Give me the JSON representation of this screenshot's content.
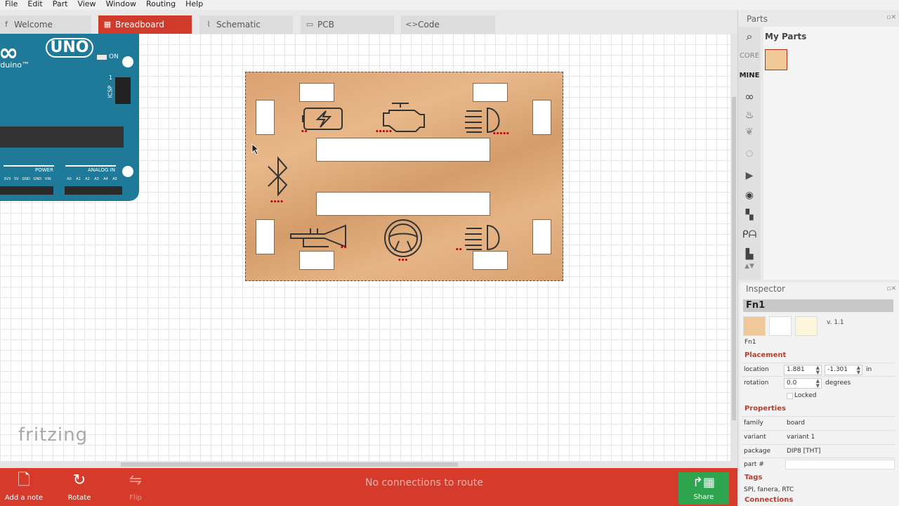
{
  "menu": [
    "File",
    "Edit",
    "Part",
    "View",
    "Window",
    "Routing",
    "Help"
  ],
  "tabs": [
    {
      "label": "Welcome",
      "icon": "fritzing-f-icon"
    },
    {
      "label": "Breadboard",
      "icon": "breadboard-icon",
      "active": true
    },
    {
      "label": "Schematic",
      "icon": "schematic-icon"
    },
    {
      "label": "PCB",
      "icon": "pcb-icon"
    },
    {
      "label": "Code",
      "icon": "code-icon"
    }
  ],
  "arduino": {
    "logo": "∞",
    "model": "UNO",
    "brand": "rduino™",
    "on_label": "ON",
    "icsp_label": "ICSP",
    "icsp_pin": "1",
    "power_label": "POWER",
    "analog_label": "ANALOG IN",
    "power_pins": [
      "3V3",
      "5V",
      "GND",
      "GND",
      "VIN"
    ],
    "analog_pins": [
      "A0",
      "A1",
      "A2",
      "A3",
      "A4",
      "A5"
    ]
  },
  "board": {
    "icons": [
      "battery-icon",
      "engine-icon",
      "headlight-icon",
      "bluetooth-icon",
      "horn-icon",
      "steering-wheel-icon",
      "headlight-icon"
    ],
    "marks": [
      "••",
      "•••••",
      "•••••",
      "••••",
      "••",
      "•••",
      "••"
    ]
  },
  "brand_watermark": "fritzing",
  "parts_panel": {
    "title": "Parts",
    "bins": [
      "CORE",
      "MINE"
    ],
    "active_bin": "MINE",
    "bin_title": "My Parts"
  },
  "inspector": {
    "title": "Inspector",
    "part_name": "Fn1",
    "version": "v. 1.1",
    "part_id": "Fn1",
    "placement_title": "Placement",
    "location_label": "location",
    "location_x": "1.881",
    "location_y": "-1.301",
    "location_unit": "in",
    "rotation_label": "rotation",
    "rotation": "0.0",
    "rotation_unit": "degrees",
    "locked_label": "Locked",
    "properties_title": "Properties",
    "properties": [
      {
        "key": "family",
        "value": "board"
      },
      {
        "key": "variant",
        "value": "variant 1"
      },
      {
        "key": "package",
        "value": "DIP8 [THT]"
      },
      {
        "key": "part #",
        "value": ""
      }
    ],
    "tags_title": "Tags",
    "tags": "SPI, fanera, RTC",
    "connections_title": "Connections"
  },
  "toolbar": {
    "add_note": "Add a note",
    "rotate": "Rotate",
    "flip": "Flip",
    "status": "No connections to route",
    "share": "Share"
  },
  "colors": {
    "accent": "#d53a2b",
    "share": "#2ea44f",
    "arduino": "#1f7a9a"
  }
}
